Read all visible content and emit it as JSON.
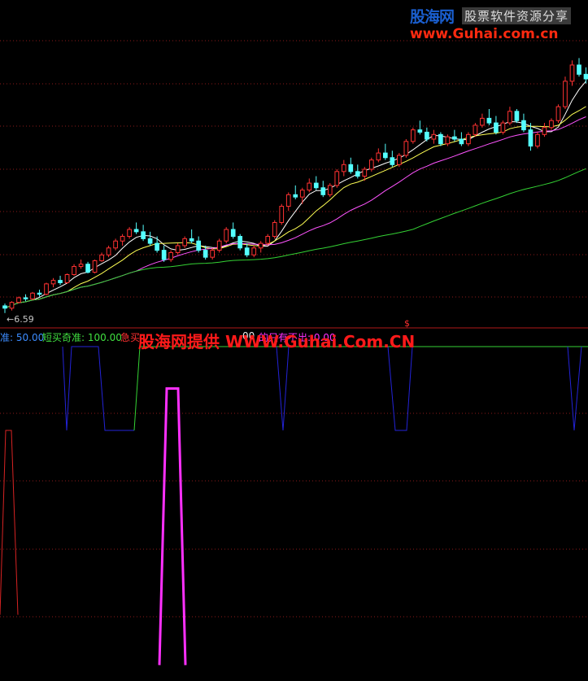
{
  "logo": {
    "brand": "股海网",
    "tagline": "股票软件资源分享",
    "url": "www.Guhai.com.cn"
  },
  "watermark": {
    "text": "股海网提供 WWW.Guhai.Com.CN"
  },
  "price_panel": {
    "min_label": "←6.59",
    "marker": "$"
  },
  "indicator_legend": [
    {
      "text": "准: 50.00",
      "color": "#3c8cff"
    },
    {
      "text": "短买奇准: 100.00",
      "color": "#40e040"
    },
    {
      "text": "急买",
      "color": "#ff3030"
    },
    {
      "text": "00",
      "color": "#e8e8e8"
    },
    {
      "text": "的只有不出: 0.00",
      "color": "#ff30ff"
    }
  ],
  "colors": {
    "up": "#ff3232",
    "down": "#54ffff",
    "ma_fast": "#ffffff",
    "ma_mid": "#ffff54",
    "ma_slow": "#ff54ff",
    "ma_long": "#34d234",
    "grid": "#8b1a1a",
    "ind_blue": "#2323d8",
    "ind_green": "#34d234",
    "ind_red": "#d82323",
    "ind_magenta": "#ff30ff"
  },
  "chart_data": [
    {
      "type": "candlestick",
      "candles": [
        [
          6.9,
          7.0,
          6.59,
          6.8
        ],
        [
          6.8,
          7.1,
          6.7,
          7.05
        ],
        [
          7.05,
          7.3,
          7.0,
          7.25
        ],
        [
          7.25,
          7.4,
          7.1,
          7.2
        ],
        [
          7.2,
          7.5,
          7.15,
          7.45
        ],
        [
          7.45,
          7.6,
          7.3,
          7.4
        ],
        [
          7.4,
          7.9,
          7.35,
          7.85
        ],
        [
          7.85,
          8.1,
          7.7,
          8.0
        ],
        [
          8.0,
          8.2,
          7.8,
          7.9
        ],
        [
          7.9,
          8.3,
          7.85,
          8.25
        ],
        [
          8.25,
          8.7,
          8.2,
          8.6
        ],
        [
          8.6,
          8.9,
          8.5,
          8.7
        ],
        [
          8.7,
          8.8,
          8.3,
          8.35
        ],
        [
          8.35,
          8.9,
          8.3,
          8.85
        ],
        [
          8.85,
          9.2,
          8.8,
          9.1
        ],
        [
          9.1,
          9.5,
          9.0,
          9.4
        ],
        [
          9.4,
          9.8,
          9.3,
          9.7
        ],
        [
          9.7,
          10.0,
          9.5,
          9.9
        ],
        [
          9.9,
          10.3,
          9.8,
          10.2
        ],
        [
          10.2,
          10.5,
          10.0,
          10.1
        ],
        [
          10.1,
          10.4,
          9.7,
          9.8
        ],
        [
          9.8,
          10.1,
          9.5,
          9.6
        ],
        [
          9.6,
          9.9,
          9.2,
          9.3
        ],
        [
          9.3,
          9.5,
          8.8,
          8.9
        ],
        [
          8.9,
          9.3,
          8.8,
          9.2
        ],
        [
          9.2,
          9.6,
          9.1,
          9.5
        ],
        [
          9.5,
          9.9,
          9.4,
          9.8
        ],
        [
          9.8,
          10.2,
          9.6,
          9.7
        ],
        [
          9.7,
          9.9,
          9.2,
          9.3
        ],
        [
          9.3,
          9.5,
          8.9,
          9.0
        ],
        [
          9.0,
          9.4,
          8.9,
          9.3
        ],
        [
          9.3,
          9.8,
          9.2,
          9.7
        ],
        [
          9.7,
          10.3,
          9.6,
          10.2
        ],
        [
          10.2,
          10.5,
          9.8,
          9.9
        ],
        [
          9.9,
          10.0,
          9.3,
          9.4
        ],
        [
          9.4,
          9.6,
          9.0,
          9.1
        ],
        [
          9.1,
          9.5,
          9.0,
          9.4
        ],
        [
          9.4,
          9.7,
          9.2,
          9.6
        ],
        [
          9.6,
          10.0,
          9.5,
          9.9
        ],
        [
          9.9,
          10.6,
          9.8,
          10.5
        ],
        [
          10.5,
          11.3,
          10.4,
          11.2
        ],
        [
          11.2,
          11.8,
          11.0,
          11.7
        ],
        [
          11.7,
          12.1,
          11.5,
          11.6
        ],
        [
          11.6,
          12.0,
          11.3,
          11.9
        ],
        [
          11.9,
          12.4,
          11.8,
          12.2
        ],
        [
          12.2,
          12.5,
          11.9,
          12.0
        ],
        [
          12.0,
          12.3,
          11.6,
          11.7
        ],
        [
          11.7,
          12.2,
          11.6,
          12.1
        ],
        [
          12.1,
          12.8,
          12.0,
          12.7
        ],
        [
          12.7,
          13.2,
          12.5,
          13.0
        ],
        [
          13.0,
          13.3,
          12.6,
          12.7
        ],
        [
          12.7,
          13.0,
          12.4,
          12.5
        ],
        [
          12.5,
          12.9,
          12.3,
          12.8
        ],
        [
          12.8,
          13.3,
          12.7,
          13.2
        ],
        [
          13.2,
          13.7,
          13.1,
          13.5
        ],
        [
          13.5,
          13.9,
          13.2,
          13.3
        ],
        [
          13.3,
          13.6,
          12.9,
          13.0
        ],
        [
          13.0,
          13.5,
          12.9,
          13.4
        ],
        [
          13.4,
          14.1,
          13.3,
          14.0
        ],
        [
          14.0,
          14.6,
          13.9,
          14.5
        ],
        [
          14.5,
          14.9,
          14.3,
          14.4
        ],
        [
          14.4,
          14.6,
          14.0,
          14.1
        ],
        [
          14.1,
          14.5,
          13.9,
          14.3
        ],
        [
          14.3,
          14.4,
          13.8,
          13.9
        ],
        [
          13.9,
          14.3,
          13.8,
          14.2
        ],
        [
          14.2,
          14.5,
          14.0,
          14.1
        ],
        [
          14.1,
          14.4,
          13.8,
          13.9
        ],
        [
          13.9,
          14.4,
          13.8,
          14.3
        ],
        [
          14.3,
          14.8,
          14.2,
          14.7
        ],
        [
          14.7,
          15.2,
          14.6,
          15.0
        ],
        [
          15.0,
          15.4,
          14.7,
          14.8
        ],
        [
          14.8,
          15.1,
          14.3,
          14.4
        ],
        [
          14.4,
          14.9,
          14.3,
          14.8
        ],
        [
          14.8,
          15.5,
          14.7,
          15.3
        ],
        [
          15.3,
          15.4,
          14.8,
          14.9
        ],
        [
          14.9,
          15.2,
          14.4,
          14.5
        ],
        [
          14.5,
          14.8,
          13.6,
          13.8
        ],
        [
          13.8,
          14.4,
          13.7,
          14.3
        ],
        [
          14.3,
          14.8,
          14.2,
          14.6
        ],
        [
          14.6,
          15.0,
          14.5,
          14.9
        ],
        [
          14.9,
          15.6,
          14.8,
          15.5
        ],
        [
          15.5,
          16.8,
          15.4,
          16.6
        ],
        [
          16.6,
          17.5,
          16.4,
          17.3
        ],
        [
          17.3,
          17.6,
          16.8,
          16.9
        ],
        [
          16.9,
          17.2,
          16.5,
          16.7
        ]
      ],
      "ma_periods": [
        5,
        10,
        20,
        60
      ],
      "ylim": [
        6.3,
        18.0
      ]
    },
    {
      "type": "line",
      "ylim": [
        0,
        100
      ],
      "series": [
        {
          "color_key": "ind_blue",
          "x": [
            77,
            82,
            88,
            121,
            129,
            165
          ],
          "values": [
            100,
            50,
            100,
            100,
            50,
            50
          ]
        },
        {
          "color_key": "ind_green",
          "x": [
            165,
            172,
            723
          ],
          "values": [
            50,
            100,
            100
          ]
        },
        {
          "color_key": "ind_blue",
          "x": [
            340,
            348,
            355
          ],
          "values": [
            100,
            50,
            100
          ]
        },
        {
          "color_key": "ind_blue",
          "x": [
            477,
            486,
            500,
            507
          ],
          "values": [
            100,
            50,
            50,
            100
          ]
        },
        {
          "color_key": "ind_blue",
          "x": [
            698,
            706,
            715
          ],
          "values": [
            100,
            50,
            100
          ]
        },
        {
          "color_key": "ind_red",
          "x": [
            0,
            7,
            14,
            22
          ],
          "values": [
            -60,
            50,
            50,
            -60
          ]
        },
        {
          "color_key": "ind_magenta",
          "x": [
            196,
            205,
            219,
            228
          ],
          "values": [
            -90,
            75,
            75,
            -90
          ]
        }
      ]
    }
  ]
}
